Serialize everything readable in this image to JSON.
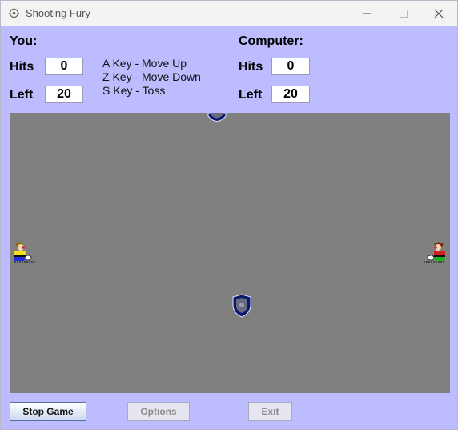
{
  "window": {
    "title": "Shooting Fury",
    "icon": "gear-icon"
  },
  "player": {
    "heading": "You:",
    "hits_label": "Hits",
    "hits": "0",
    "left_label": "Left",
    "left": "20"
  },
  "computer": {
    "heading": "Computer:",
    "hits_label": "Hits",
    "hits": "0",
    "left_label": "Left",
    "left": "20"
  },
  "controls": {
    "up": "A Key - Move Up",
    "down": "Z Key - Move Down",
    "toss": "S Key - Toss"
  },
  "buttons": {
    "stop": "Stop Game",
    "options": "Options",
    "exit": "Exit"
  },
  "colors": {
    "background": "#bcbcff",
    "field": "#808080",
    "shield": "#0a1a6e"
  }
}
